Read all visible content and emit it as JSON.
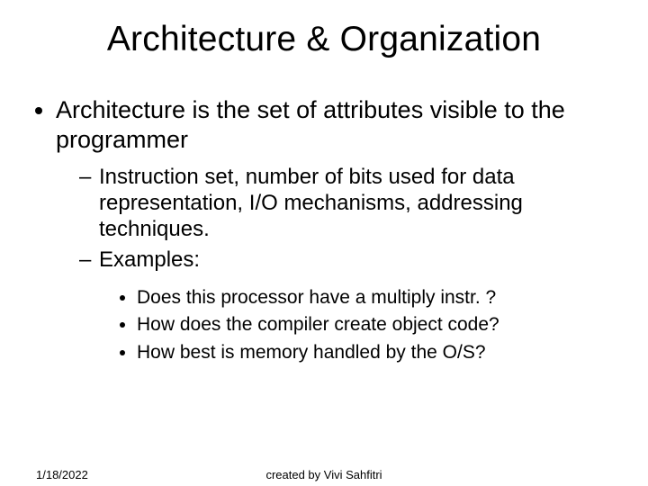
{
  "title": "Architecture & Organization",
  "bullet1": "Architecture is the set of attributes visible to the programmer",
  "sub1": "Instruction set, number of bits used for data representation, I/O mechanisms, addressing techniques.",
  "sub2": "Examples:",
  "ex1": "Does this processor have a multiply instr. ?",
  "ex2": "How does the compiler create object code?",
  "ex3": "How best is memory handled by the O/S?",
  "footer": {
    "date": "1/18/2022",
    "author": "created by Vivi Sahfitri"
  }
}
